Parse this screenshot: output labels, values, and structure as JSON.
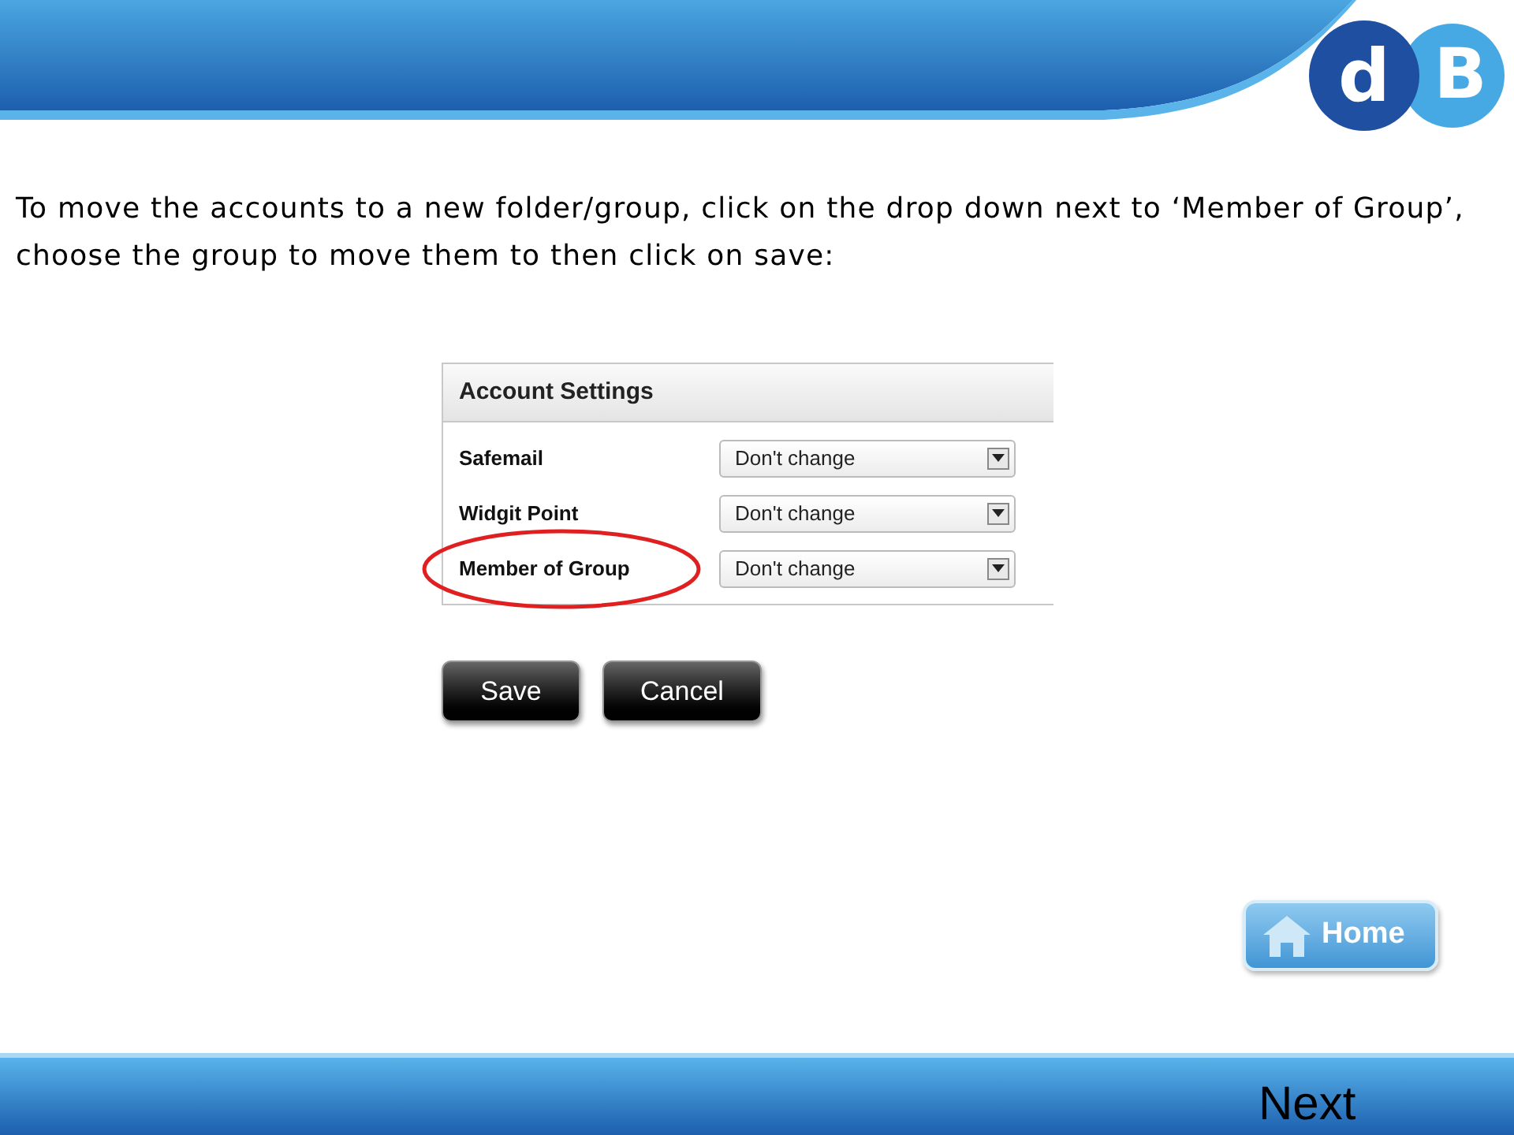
{
  "logo": {
    "left": "d",
    "right": "B"
  },
  "instruction": "To move the accounts to a new folder/group, click on the drop down next to ‘Member of Group’, choose the group to move them to then click on save:",
  "panel": {
    "title": "Account Settings",
    "rows": [
      {
        "label": "Safemail",
        "value": "Don't change",
        "highlighted": false
      },
      {
        "label": "Widgit Point",
        "value": "Don't change",
        "highlighted": false
      },
      {
        "label": "Member of Group",
        "value": "Don't change",
        "highlighted": true
      }
    ]
  },
  "buttons": [
    "Save",
    "Cancel"
  ],
  "home_button": "Home",
  "next_button": "Next"
}
